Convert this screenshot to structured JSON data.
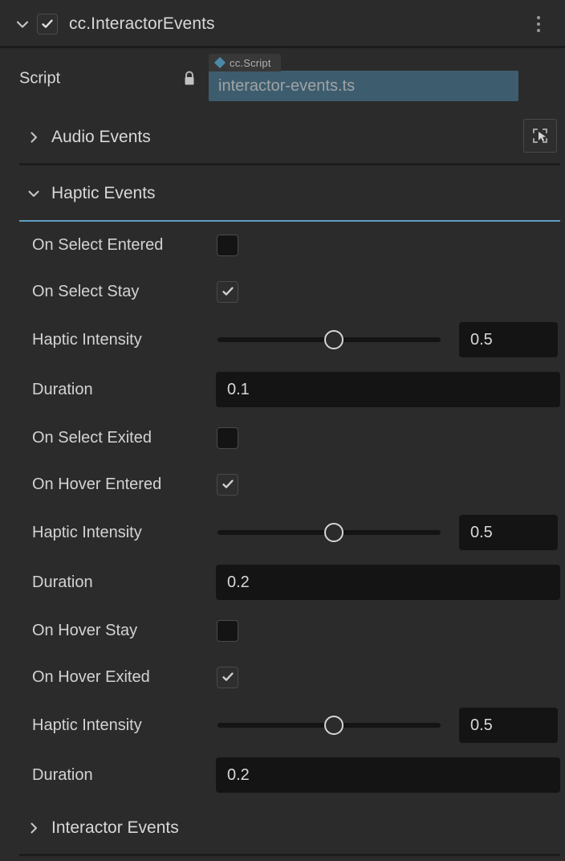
{
  "header": {
    "title": "cc.InteractorEvents",
    "enabled": true,
    "twisty": "chevron-down-icon",
    "menu": "kebab-menu-icon"
  },
  "script_row": {
    "label": "Script",
    "lock": "lock-icon",
    "asset_type": "cc.Script",
    "asset_value": "interactor-events.ts",
    "picker": "node-picker-icon"
  },
  "sections": [
    {
      "label": "Audio Events",
      "expanded": false,
      "twisty": "chevron-right-icon"
    },
    {
      "label": "Haptic Events",
      "expanded": true,
      "twisty": "chevron-down-icon"
    },
    {
      "label": "Interactor Events",
      "expanded": false,
      "twisty": "chevron-right-icon"
    }
  ],
  "haptic_properties": [
    {
      "label": "On Select Entered",
      "type": "checkbox",
      "value": false
    },
    {
      "label": "On Select Stay",
      "type": "checkbox",
      "value": true
    },
    {
      "label": "Haptic Intensity",
      "type": "slider",
      "value": "0.5",
      "percent": 52
    },
    {
      "label": "Duration",
      "type": "number",
      "value": "0.1"
    },
    {
      "label": "On Select Exited",
      "type": "checkbox",
      "value": false
    },
    {
      "label": "On Hover Entered",
      "type": "checkbox",
      "value": true
    },
    {
      "label": "Haptic Intensity",
      "type": "slider",
      "value": "0.5",
      "percent": 52
    },
    {
      "label": "Duration",
      "type": "number",
      "value": "0.2"
    },
    {
      "label": "On Hover Stay",
      "type": "checkbox",
      "value": false
    },
    {
      "label": "On Hover Exited",
      "type": "checkbox",
      "value": true
    },
    {
      "label": "Haptic Intensity",
      "type": "slider",
      "value": "0.5",
      "percent": 52
    },
    {
      "label": "Duration",
      "type": "number",
      "value": "0.2"
    }
  ],
  "colors": {
    "background": "#2b2b2b",
    "accent_underline": "#5e9ec4",
    "asset_field": "#3d5d6e",
    "asset_diamond": "#4a8aa8",
    "input_background": "#141414",
    "text": "#d8d8d8"
  }
}
